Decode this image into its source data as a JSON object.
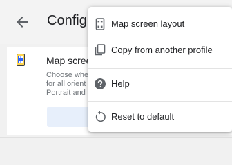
{
  "header": {
    "title": "Configure",
    "back_icon": "arrow-back-icon"
  },
  "card": {
    "icon": "phone-layout-icon",
    "title": "Map screen layout",
    "description_lines": [
      "Choose where",
      "for all orient",
      "Portrait and"
    ]
  },
  "menu": {
    "items": [
      {
        "label": "Map screen layout",
        "icon": "phone-layout-icon"
      },
      {
        "label": "Copy from another profile",
        "icon": "copy-icon"
      },
      {
        "label": "Help",
        "icon": "help-icon"
      },
      {
        "label": "Reset to default",
        "icon": "reset-icon"
      }
    ]
  },
  "colors": {
    "accent": "#1a73e8",
    "icon_gray": "#5f6368",
    "text": "#202124"
  }
}
